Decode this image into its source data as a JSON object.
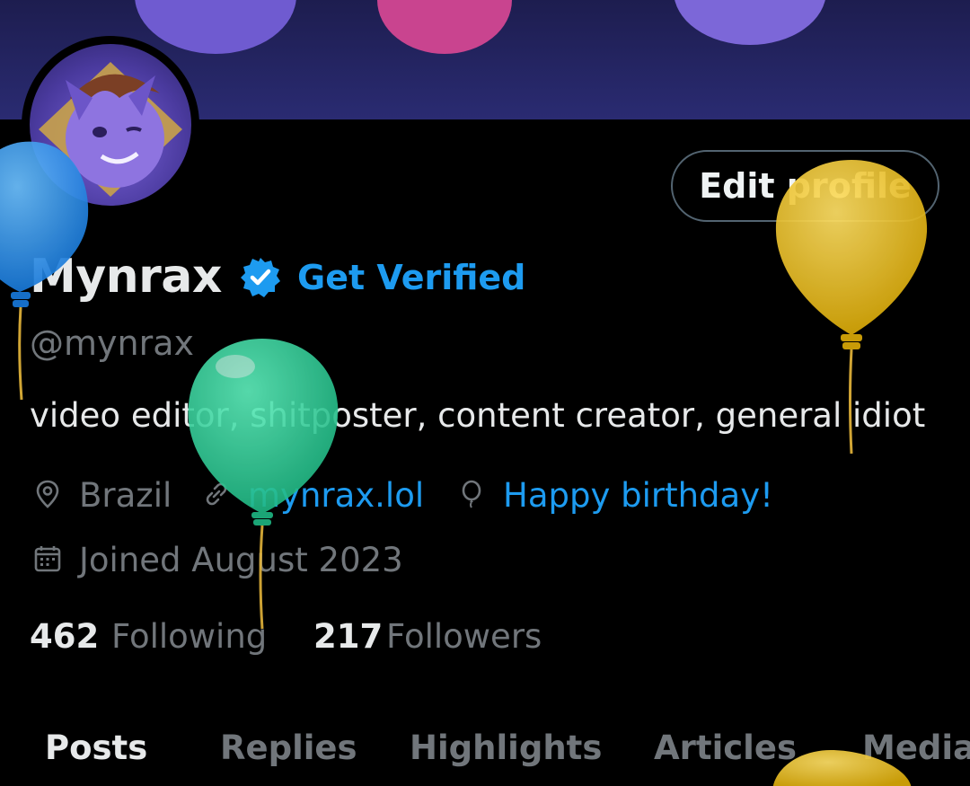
{
  "colors": {
    "background": "#000000",
    "banner": "#2a2b72",
    "text_primary": "#e7e9ea",
    "text_secondary": "#71767b",
    "accent": "#1d9bf0",
    "button_border": "#536471",
    "balloon_blue": "#2196f3",
    "balloon_yellow": "#e8b90e",
    "balloon_green": "#2ed49a"
  },
  "header": {
    "edit_profile_label": "Edit profile"
  },
  "profile": {
    "avatar_icon": "avatar-image",
    "name": "Mynrax",
    "verified_icon": "verified-badge-icon",
    "get_verified_label": "Get Verified",
    "handle": "@mynrax",
    "bio": "video editor, shitposter, content creator, general idiot"
  },
  "meta": {
    "location": {
      "icon": "location-pin-icon",
      "text": "Brazil"
    },
    "website": {
      "icon": "link-icon",
      "text": "mynrax.lol"
    },
    "birthday": {
      "icon": "balloon-icon",
      "text": "Happy birthday!"
    },
    "joined": {
      "icon": "calendar-icon",
      "text": "Joined August 2023"
    }
  },
  "stats": {
    "following_count": "462",
    "following_label": "Following",
    "followers_count": "217",
    "followers_label": "Followers"
  },
  "tabs": [
    {
      "label": "Posts",
      "active": true
    },
    {
      "label": "Replies",
      "active": false
    },
    {
      "label": "Highlights",
      "active": false
    },
    {
      "label": "Articles",
      "active": false
    },
    {
      "label": "Media",
      "active": false
    }
  ]
}
